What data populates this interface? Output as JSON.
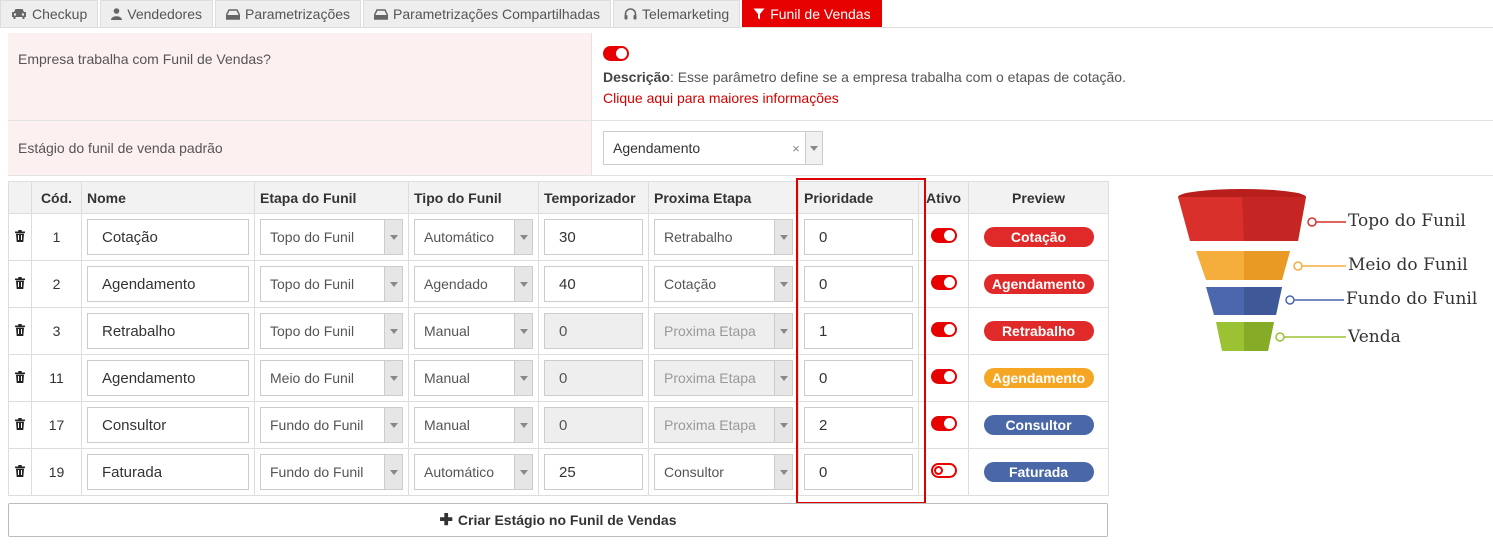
{
  "tabs": [
    {
      "label": "Checkup",
      "icon": "car-icon",
      "active": false
    },
    {
      "label": "Vendedores",
      "icon": "user-icon",
      "active": false
    },
    {
      "label": "Parametrizações",
      "icon": "hdd-icon",
      "active": false
    },
    {
      "label": "Parametrizações Compartilhadas",
      "icon": "hdd-icon",
      "active": false
    },
    {
      "label": "Telemarketing",
      "icon": "headset-icon",
      "active": false
    },
    {
      "label": "Funil de Vendas",
      "icon": "filter-icon",
      "active": true
    }
  ],
  "settings": {
    "funnel_enabled": {
      "label": "Empresa trabalha com Funil de Vendas?",
      "toggle_on": true,
      "desc_label": "Descrição",
      "desc_text": ": Esse parâmetro define se a empresa trabalha com o etapas de cotação.",
      "link": "Clique aqui para maiores informações"
    },
    "default_stage": {
      "label": "Estágio do funil de venda padrão",
      "value": "Agendamento",
      "clear": "×"
    }
  },
  "table": {
    "headers": {
      "code": "Cód.",
      "name": "Nome",
      "stage": "Etapa do Funil",
      "type": "Tipo do Funil",
      "timer": "Temporizador",
      "next": "Proxima Etapa",
      "priority": "Prioridade",
      "active": "Ativo",
      "preview": "Preview"
    },
    "rows": [
      {
        "code": "1",
        "name": "Cotação",
        "stage": "Topo do Funil",
        "type": "Automático",
        "timer": "30",
        "timer_disabled": false,
        "next": "Retrabalho",
        "next_disabled": false,
        "priority": "0",
        "active": true,
        "preview": "Cotação",
        "preview_color": "#e02a2a"
      },
      {
        "code": "2",
        "name": "Agendamento",
        "stage": "Topo do Funil",
        "type": "Agendado",
        "timer": "40",
        "timer_disabled": false,
        "next": "Cotação",
        "next_disabled": false,
        "priority": "0",
        "active": true,
        "preview": "Agendamento",
        "preview_color": "#e02a2a"
      },
      {
        "code": "3",
        "name": "Retrabalho",
        "stage": "Topo do Funil",
        "type": "Manual",
        "timer": "0",
        "timer_disabled": true,
        "next": "Proxima Etapa",
        "next_disabled": true,
        "priority": "1",
        "active": true,
        "preview": "Retrabalho",
        "preview_color": "#e02a2a"
      },
      {
        "code": "11",
        "name": "Agendamento",
        "stage": "Meio do Funil",
        "type": "Manual",
        "timer": "0",
        "timer_disabled": true,
        "next": "Proxima Etapa",
        "next_disabled": true,
        "priority": "0",
        "active": true,
        "preview": "Agendamento",
        "preview_color": "#f5a623"
      },
      {
        "code": "17",
        "name": "Consultor",
        "stage": "Fundo do Funil",
        "type": "Manual",
        "timer": "0",
        "timer_disabled": true,
        "next": "Proxima Etapa",
        "next_disabled": true,
        "priority": "2",
        "active": true,
        "preview": "Consultor",
        "preview_color": "#4a67a8"
      },
      {
        "code": "19",
        "name": "Faturada",
        "stage": "Fundo do Funil",
        "type": "Automático",
        "timer": "25",
        "timer_disabled": false,
        "next": "Consultor",
        "next_disabled": false,
        "priority": "0",
        "active": false,
        "preview": "Faturada",
        "preview_color": "#4a67a8"
      }
    ]
  },
  "create_button": "Criar Estágio no Funil de Vendas",
  "funnel": {
    "levels": [
      {
        "label": "Topo do Funil",
        "color": "#d9302c"
      },
      {
        "label": "Meio do Funil",
        "color": "#f5ad3b"
      },
      {
        "label": "Fundo do Funil",
        "color": "#4c67ad"
      },
      {
        "label": "Venda",
        "color": "#9ac233"
      }
    ]
  },
  "colors": {
    "accent": "#e60000",
    "link": "#d40000"
  }
}
